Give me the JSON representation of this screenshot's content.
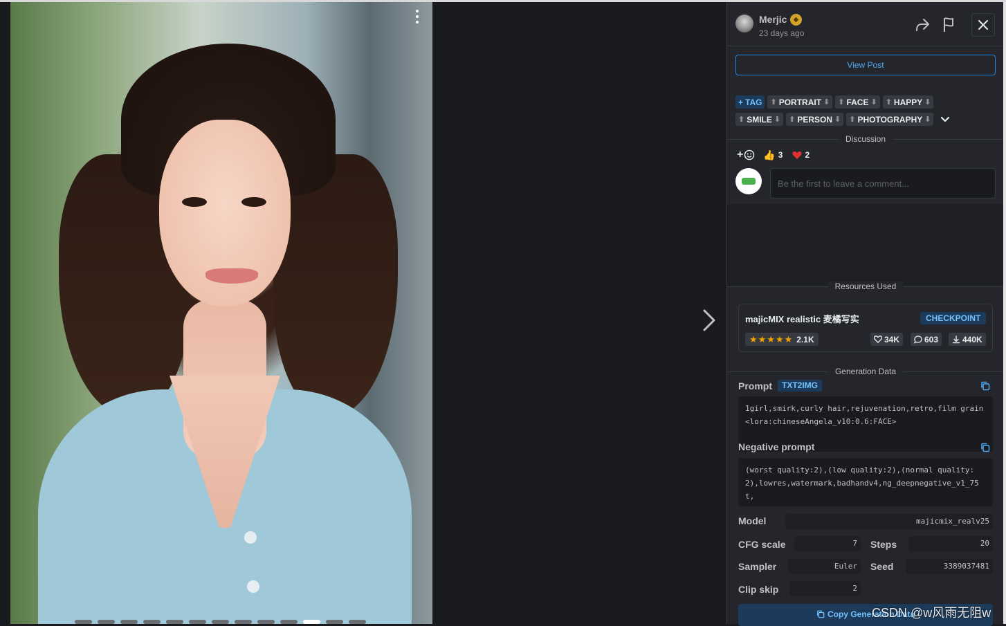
{
  "header": {
    "username": "Merjic",
    "time_ago": "23 days ago",
    "badge_icon": "creator-badge-icon"
  },
  "view_post_label": "View Post",
  "tags": {
    "add_label": "TAG",
    "items": [
      "PORTRAIT",
      "FACE",
      "HAPPY",
      "SMILE",
      "PERSON",
      "PHOTOGRAPHY"
    ]
  },
  "discussion": {
    "section_label": "Discussion",
    "likes": "3",
    "hearts": "2",
    "comment_placeholder": "Be the first to leave a comment..."
  },
  "resources": {
    "section_label": "Resources Used",
    "name": "majicMIX realistic 麦橘写实",
    "type_badge": "CHECKPOINT",
    "rating_count": "2.1K",
    "favorites": "34K",
    "comments": "603",
    "downloads": "440K"
  },
  "generation": {
    "section_label": "Generation Data",
    "prompt_label": "Prompt",
    "prompt_type": "TXT2IMG",
    "prompt": "1girl,smirk,curly hair,rejuvenation,retro,film grain <lora:chineseAngela_v10:0.6:FACE>",
    "negative_label": "Negative prompt",
    "negative_prompt": "(worst quality:2),(low quality:2),(normal quality:2),lowres,watermark,badhandv4,ng_deepnegative_v1_75t,",
    "model_label": "Model",
    "model": "majicmix_realv25",
    "cfg_label": "CFG scale",
    "cfg": "7",
    "steps_label": "Steps",
    "steps": "20",
    "sampler_label": "Sampler",
    "sampler": "Euler",
    "seed_label": "Seed",
    "seed": "3389037481",
    "clipskip_label": "Clip skip",
    "clipskip": "2",
    "copy_label": "Copy Generation Data"
  },
  "watermark": "CSDN @w风雨无阻w",
  "colors": {
    "accent": "#228be6",
    "panel_bg": "#25262b",
    "viewer_bg": "#1a1b1e",
    "star": "#f59f00",
    "heart": "#e03131"
  }
}
